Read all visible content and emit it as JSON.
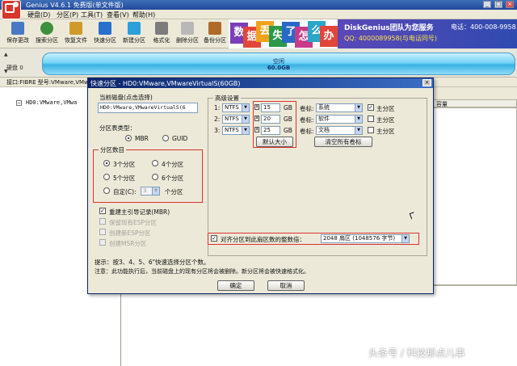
{
  "window": {
    "title": "Genius V4.6.1 免费版(单文件版)",
    "controls": [
      "_",
      "□",
      "×"
    ]
  },
  "menubar": {
    "items": [
      "硬盘(D)",
      "分区(P)",
      "工具(T)",
      "查看(V)",
      "帮助(H)"
    ]
  },
  "toolbar": {
    "buttons": [
      {
        "label": "保存更改",
        "icon": "save-icon",
        "color": "#4a79c4"
      },
      {
        "label": "搜索分区",
        "icon": "search-partition-icon",
        "color": "#3e8f3e"
      },
      {
        "label": "恢复文件",
        "icon": "recover-file-icon",
        "color": "#d09a2a"
      },
      {
        "label": "快速分区",
        "icon": "quick-partition-icon",
        "color": "#2a6fc9"
      },
      {
        "label": "新建分区",
        "icon": "new-partition-icon",
        "color": "#2a9fd9"
      },
      {
        "label": "格式化",
        "icon": "format-icon",
        "color": "#7c7c7c"
      },
      {
        "label": "删除分区",
        "icon": "delete-partition-icon",
        "color": "#b8b8b8"
      },
      {
        "label": "备份分区",
        "icon": "backup-partition-icon",
        "color": "#b06a2a"
      }
    ]
  },
  "banner": {
    "blocks": [
      {
        "char": "数",
        "color": "#7a3fb8"
      },
      {
        "char": "据",
        "color": "#e2463a"
      },
      {
        "char": "丢",
        "color": "#f1a21b"
      },
      {
        "char": "失",
        "color": "#2a9a4a"
      },
      {
        "char": "了",
        "color": "#2a68c8"
      },
      {
        "char": "怎",
        "color": "#c83a8a"
      },
      {
        "char": "么",
        "color": "#2aa6c8"
      },
      {
        "char": "办",
        "color": "#e2463a"
      }
    ],
    "brand": "DiskGenius团队为您服务",
    "phone": "电话：400-008-9958",
    "qq": "QQ: 4000089958(与电话同号)",
    "extra": "(与电话同号)"
  },
  "diskbar": {
    "disk_label": "硬盘 0",
    "partition_label": "空闲",
    "partition_size": "60.0GB"
  },
  "infobar": {
    "text": "接口:FIBRE  型号:VMware,VMwareVirtualS"
  },
  "tree": {
    "disk_item": "HD0:VMware,VMwa"
  },
  "right_panel": {
    "column_header": "容量"
  },
  "dialog": {
    "title": "快速分区 - HD0:VMware,VMwareVirtualS(60GB)",
    "current_disk_title": "当前磁盘(点击选择)",
    "current_disk_value": "HD0:VMware,VMwareVirtualS(6",
    "table_type_title": "分区表类型：",
    "table_types": [
      {
        "label": "MBR",
        "selected": true
      },
      {
        "label": "GUID",
        "selected": false
      }
    ],
    "count_title": "分区数目",
    "counts": [
      {
        "label": "3个分区",
        "selected": true
      },
      {
        "label": "4个分区",
        "selected": false
      },
      {
        "label": "5个分区",
        "selected": false
      },
      {
        "label": "6个分区",
        "selected": false
      }
    ],
    "custom": {
      "label": "自定(C):",
      "value": "3",
      "suffix": "个分区"
    },
    "mbr_rebuild": {
      "label": "重建主引导记录(MBR)",
      "checked": true
    },
    "disabled_options": [
      "保留现有ESP分区",
      "创建新ESP分区",
      "创建MSR分区"
    ],
    "advanced_title": "高级设置",
    "partitions": [
      {
        "index": "1:",
        "fs": "NTFS",
        "size": "15",
        "unit": "GB",
        "label_title": "卷标:",
        "label": "系统",
        "primary": "主分区",
        "primary_checked": true
      },
      {
        "index": "2:",
        "fs": "NTFS",
        "size": "20",
        "unit": "GB",
        "label_title": "卷标:",
        "label": "软件",
        "primary": "主分区",
        "primary_checked": false
      },
      {
        "index": "3:",
        "fs": "NTFS",
        "size": "25",
        "unit": "GB",
        "label_title": "卷标:",
        "label": "文档",
        "primary": "主分区",
        "primary_checked": false
      }
    ],
    "default_size_button": "默认大小",
    "clear_labels_button": "清空所有卷标",
    "align": {
      "label": "对齐分区到此扇区数的整数倍：",
      "checked": true,
      "value": "2048 扇区 (1048576 字节)"
    },
    "hint_line1": "提示：按3、4、5、6\"快速选择分区个数。",
    "hint_line2": "注意：此功能执行后，当前磁盘上的现有分区将会被删除。新分区将会被快速格式化。",
    "ok_button": "确定",
    "cancel_button": "取消"
  },
  "watermark": "头条号 / 科技那点儿事"
}
